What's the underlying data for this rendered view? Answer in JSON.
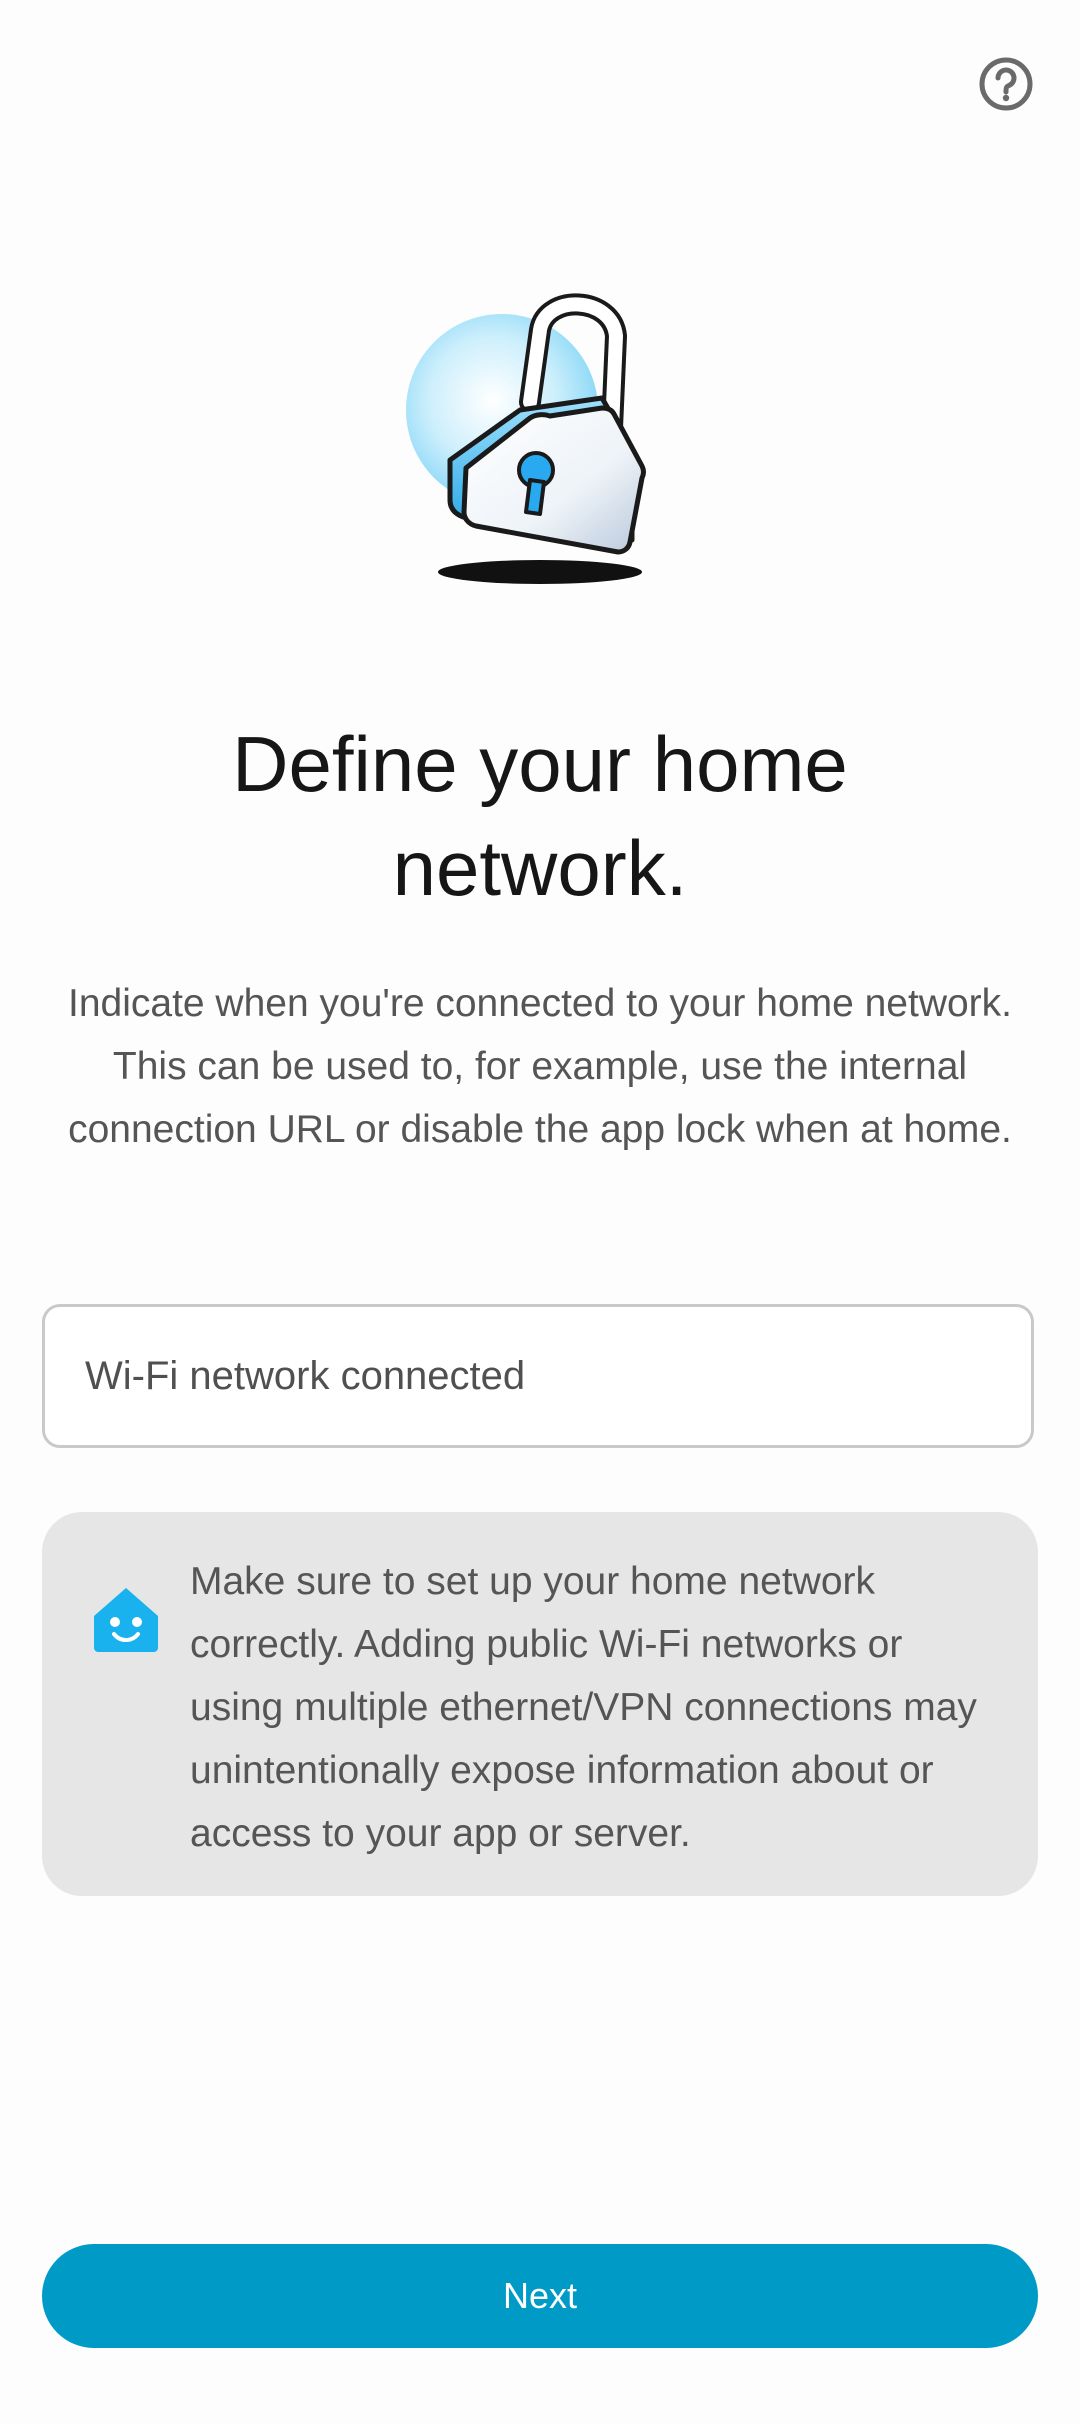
{
  "header": {
    "help_icon": "help-circle-icon"
  },
  "hero": {
    "illustration": "padlock-home-illustration",
    "accent_color": "#3aaee0"
  },
  "page": {
    "title": "Define your home network.",
    "description": "Indicate when you're connected to your home network. This can be used to, for example, use the internal connection URL or disable the app lock when at home."
  },
  "network_field": {
    "value": "Wi-Fi network connected"
  },
  "notice": {
    "icon": "home-assistant-icon",
    "icon_color": "#19b2ee",
    "text": "Make sure to set up your home network correctly. Adding public Wi-Fi networks or using multiple ethernet/VPN connections may unintentionally expose information about or access to your app or server."
  },
  "footer": {
    "next_label": "Next",
    "button_color": "#009ac7"
  }
}
